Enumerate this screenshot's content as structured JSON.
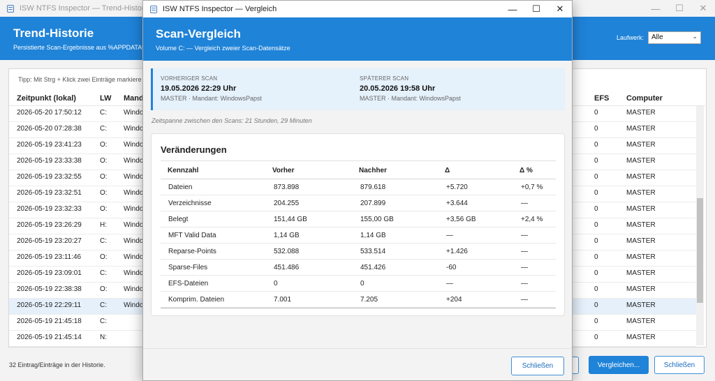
{
  "bg_window": {
    "title": "ISW NTFS Inspector — Trend-Historie",
    "header_title": "Trend-Historie",
    "header_subtitle": "Persistierte Scan-Ergebnisse aus %APPDATA%",
    "drive_label": "Laufwerk:",
    "drive_value": "Alle",
    "tip": "Tipp: Mit Strg + Klick zwei Einträge markiere",
    "columns": {
      "timestamp": "Zeitpunkt (lokal)",
      "lw": "LW",
      "mandant": "Manda",
      "efs": "EFS",
      "computer": "Computer"
    },
    "rows": [
      {
        "timestamp": "2026-05-20 17:50:12",
        "lw": "C:",
        "mandant": "Windo",
        "efs": "0",
        "computer": "MASTER"
      },
      {
        "timestamp": "2026-05-20 07:28:38",
        "lw": "C:",
        "mandant": "Windo",
        "efs": "0",
        "computer": "MASTER"
      },
      {
        "timestamp": "2026-05-19 23:41:23",
        "lw": "O:",
        "mandant": "Windo",
        "efs": "0",
        "computer": "MASTER"
      },
      {
        "timestamp": "2026-05-19 23:33:38",
        "lw": "O:",
        "mandant": "Windo",
        "efs": "0",
        "computer": "MASTER"
      },
      {
        "timestamp": "2026-05-19 23:32:55",
        "lw": "O:",
        "mandant": "Windo",
        "efs": "0",
        "computer": "MASTER"
      },
      {
        "timestamp": "2026-05-19 23:32:51",
        "lw": "O:",
        "mandant": "Windo",
        "efs": "0",
        "computer": "MASTER"
      },
      {
        "timestamp": "2026-05-19 23:32:33",
        "lw": "O:",
        "mandant": "Windo",
        "efs": "0",
        "computer": "MASTER"
      },
      {
        "timestamp": "2026-05-19 23:26:29",
        "lw": "H:",
        "mandant": "Windo",
        "efs": "0",
        "computer": "MASTER"
      },
      {
        "timestamp": "2026-05-19 23:20:27",
        "lw": "C:",
        "mandant": "Windo",
        "efs": "0",
        "computer": "MASTER"
      },
      {
        "timestamp": "2026-05-19 23:11:46",
        "lw": "O:",
        "mandant": "Windo",
        "efs": "0",
        "computer": "MASTER"
      },
      {
        "timestamp": "2026-05-19 23:09:01",
        "lw": "C:",
        "mandant": "Windo",
        "efs": "0",
        "computer": "MASTER"
      },
      {
        "timestamp": "2026-05-19 22:38:38",
        "lw": "O:",
        "mandant": "Windo",
        "efs": "0",
        "computer": "MASTER"
      },
      {
        "timestamp": "2026-05-19 22:29:11",
        "lw": "C:",
        "mandant": "Windo",
        "efs": "0",
        "computer": "MASTER"
      },
      {
        "timestamp": "2026-05-19 21:45:18",
        "lw": "C:",
        "mandant": "",
        "efs": "0",
        "computer": "MASTER"
      },
      {
        "timestamp": "2026-05-19 21:45:14",
        "lw": "N:",
        "mandant": "",
        "efs": "0",
        "computer": "MASTER"
      }
    ],
    "footer_count": "32 Eintrag/Einträge in der Historie.",
    "btn_partial": "n",
    "btn_compare": "Vergleichen...",
    "btn_close": "Schließen"
  },
  "dialog": {
    "title": "ISW NTFS Inspector — Vergleich",
    "header_title": "Scan-Vergleich",
    "header_subtitle": "Volume C: — Vergleich zweier Scan-Datensätze",
    "prev_label": "VORHERIGER SCAN",
    "prev_date": "19.05.2026 22:29 Uhr",
    "prev_meta": "MASTER · Mandant: WindowsPapst",
    "next_label": "SPÄTERER SCAN",
    "next_date": "20.05.2026 19:58 Uhr",
    "next_meta": "MASTER · Mandant: WindowsPapst",
    "timespan": "Zeitspanne zwischen den Scans: 21 Stunden, 29 Minuten",
    "section_title": "Veränderungen",
    "table_headers": {
      "metric": "Kennzahl",
      "before": "Vorher",
      "after": "Nachher",
      "delta": "Δ",
      "delta_pct": "Δ %"
    },
    "table_rows": [
      {
        "metric": "Dateien",
        "before": "873.898",
        "after": "879.618",
        "delta": "+5.720",
        "delta_pct": "+0,7 %"
      },
      {
        "metric": "Verzeichnisse",
        "before": "204.255",
        "after": "207.899",
        "delta": "+3.644",
        "delta_pct": "—"
      },
      {
        "metric": "Belegt",
        "before": "151,44 GB",
        "after": "155,00 GB",
        "delta": "+3,56 GB",
        "delta_pct": "+2,4 %"
      },
      {
        "metric": "MFT Valid Data",
        "before": "1,14 GB",
        "after": "1,14 GB",
        "delta": "—",
        "delta_pct": "—"
      },
      {
        "metric": "Reparse-Points",
        "before": "532.088",
        "after": "533.514",
        "delta": "+1.426",
        "delta_pct": "—"
      },
      {
        "metric": "Sparse-Files",
        "before": "451.486",
        "after": "451.426",
        "delta": "-60",
        "delta_pct": "—"
      },
      {
        "metric": "EFS-Dateien",
        "before": "0",
        "after": "0",
        "delta": "—",
        "delta_pct": "—"
      },
      {
        "metric": "Komprim. Dateien",
        "before": "7.001",
        "after": "7.205",
        "delta": "+204",
        "delta_pct": "—"
      }
    ],
    "btn_close": "Schließen"
  },
  "window_controls": {
    "minimize": "—",
    "maximize": "☐",
    "close": "✕"
  },
  "selected_row_index": 12,
  "colors": {
    "accent": "#1f83d8",
    "selected_row": "#e5f0fb",
    "scan_box": "#e5f1fb"
  }
}
